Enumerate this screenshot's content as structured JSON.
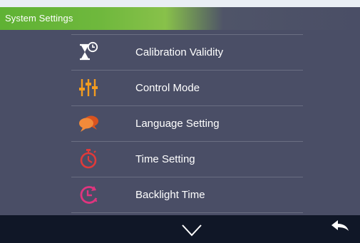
{
  "header": {
    "title": "System Settings"
  },
  "menu": {
    "items": [
      {
        "label": "Calibration Validity",
        "icon": "hourglass-clock-icon",
        "color": "#ffffff"
      },
      {
        "label": "Control Mode",
        "icon": "sliders-icon",
        "color": "#f39c1f"
      },
      {
        "label": "Language Setting",
        "icon": "speech-bubbles-icon",
        "color": "#f07a2b"
      },
      {
        "label": "Time Setting",
        "icon": "stopwatch-icon",
        "color": "#e03a3a"
      },
      {
        "label": "Backlight Time",
        "icon": "clock-cycle-icon",
        "color": "#e0357f"
      }
    ]
  },
  "bottom_bar": {
    "down_icon": "chevron-down-icon",
    "back_icon": "back-arrow-icon"
  },
  "colors": {
    "header_green": "#6fb83d",
    "background": "#4a4e66",
    "bottom_bar": "#101727"
  }
}
